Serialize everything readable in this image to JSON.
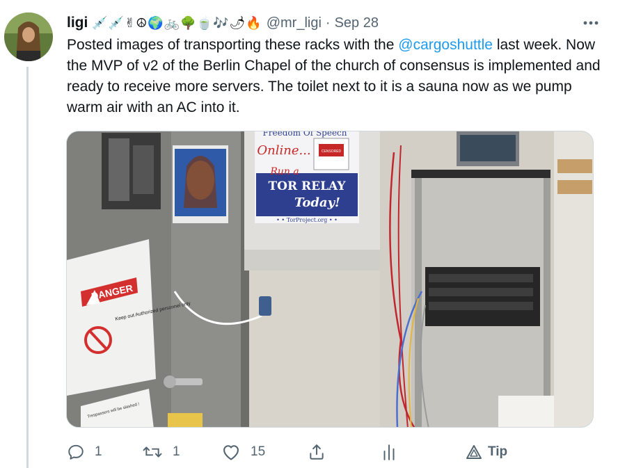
{
  "tweet": {
    "author_name": "ligi",
    "author_emojis": "💉💉✌☮🌍🚲🌳🍵🎶🌶🔥",
    "handle": "@mr_ligi",
    "separator": "·",
    "date": "Sep 28",
    "text_part1": "Posted images of transporting these racks with the ",
    "mention": "@cargoshuttle",
    "text_part2": " last week. Now the MVP of v2 of the Berlin Chapel of the church of consensus is implemented and ready to receive more servers. The toilet next to it is a sauna now as we pump warm air with an AC into it."
  },
  "media": {
    "poster_top": "Freedom Of Speech",
    "poster_online": "Online...",
    "poster_run": "Run a",
    "poster_relay": "TOR RELAY",
    "poster_today": "Today!",
    "poster_url": "• • TorProject.org • •",
    "poster_badge": "CENSORED",
    "sign_danger": "DANGER",
    "sign_keep_out": "Keep out Authorized personnel only",
    "sign_trespass": "Trespassers will be slashed !"
  },
  "actions": {
    "reply_count": "1",
    "retweet_count": "1",
    "like_count": "15",
    "tip_label": "Tip"
  },
  "colors": {
    "accent": "#1d9bf0",
    "muted": "#536471"
  }
}
